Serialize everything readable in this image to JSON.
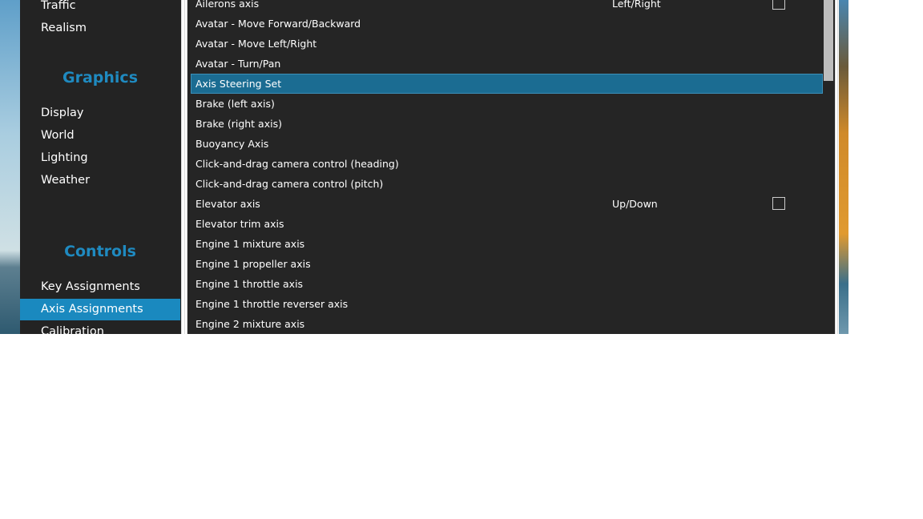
{
  "sidebar": {
    "items_top": [
      "Traffic",
      "Realism"
    ],
    "graphics_header": "Graphics",
    "graphics_items": [
      "Display",
      "World",
      "Lighting",
      "Weather"
    ],
    "controls_header": "Controls",
    "controls_items": [
      "Key Assignments",
      "Axis Assignments",
      "Calibration"
    ],
    "active": "Axis Assignments"
  },
  "axes": [
    {
      "name": "Ailerons axis",
      "direction": "Left/Right",
      "reverse": false
    },
    {
      "name": "Avatar - Move Forward/Backward"
    },
    {
      "name": "Avatar - Move Left/Right"
    },
    {
      "name": "Avatar - Turn/Pan"
    },
    {
      "name": "Axis Steering Set",
      "selected": true
    },
    {
      "name": "Brake (left axis)"
    },
    {
      "name": "Brake (right axis)"
    },
    {
      "name": "Buoyancy Axis"
    },
    {
      "name": "Click-and-drag camera control (heading)"
    },
    {
      "name": "Click-and-drag camera control (pitch)"
    },
    {
      "name": "Elevator axis",
      "direction": "Up/Down",
      "reverse": false
    },
    {
      "name": "Elevator trim axis"
    },
    {
      "name": "Engine 1 mixture axis"
    },
    {
      "name": "Engine 1 propeller axis"
    },
    {
      "name": "Engine 1 throttle axis"
    },
    {
      "name": "Engine 1 throttle reverser axis"
    },
    {
      "name": "Engine 2 mixture axis"
    }
  ],
  "colors": {
    "accent": "#1a89bf",
    "selected_row": "#1b6c92",
    "panel": "#252525"
  }
}
